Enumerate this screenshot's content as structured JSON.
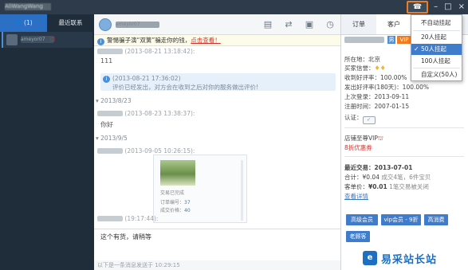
{
  "window": {
    "title": "AliWangWang 2014",
    "controls": {
      "min": "–",
      "max": "□",
      "close": "×"
    },
    "plugin_icon": "☎"
  },
  "left_panel": {
    "tabs": [
      {
        "label": "👤 (1)",
        "icon": "person-icon"
      },
      {
        "label": "最近联系"
      }
    ],
    "contact": {
      "name": "ameyor07",
      "badge": "⛫"
    }
  },
  "chat": {
    "header_name": "ameyor07",
    "tools": [
      "document-icon",
      "transfer-icon",
      "image-icon",
      "clock-icon"
    ],
    "notice": {
      "text": "警惕骗子演“双簧”骗走你的钱，",
      "link": "点击查看！"
    },
    "messages": [
      {
        "head": "(2013-08-21 13:18:42):",
        "body": "111"
      },
      {
        "head": "(2013-08-23 13:38:37):",
        "body": "你好"
      },
      {
        "head": "(2013-09-05 10:26:15):"
      },
      {
        "head": "(19:17:44):",
        "body": "这个有货，请稍等"
      }
    ],
    "system_msg": {
      "time": "(2013-08-21 17:36:02)",
      "text": "评价已经发出，对方会在收到之后对你的服务做出评价!"
    },
    "dates": [
      "▾ 2013/8/23",
      "▾ 2013/9/5"
    ],
    "item_card": {
      "caption": "交易已完成",
      "order_label": "订单编号：",
      "order_value": "37",
      "paid_label": "成交价格：",
      "paid_value": "40"
    },
    "bottom_hint": "以下是一条消息发送于 10:29:15"
  },
  "right_panel": {
    "tabs": [
      "订单",
      "客户"
    ],
    "tag_male": "男",
    "tag_vip": "VIP",
    "location_label": "所在地：",
    "location": "北京",
    "buyer_credit_label": "买家信誉：",
    "recv_rate_label": "收到好评率：",
    "recv_rate": "100.00%",
    "sent_rate_label": "发出好评率(180天)：",
    "sent_rate": "100.00%",
    "last_login_label": "上次登录：",
    "last_login": "2013-09-11",
    "reg_label": "注册时间：",
    "reg_date": "2007-01-15",
    "auth_label": "认证：",
    "vip_label": "店铺至尊VIP",
    "vip_discount": "8折优惠券",
    "recent_trade_label": "最近交易：",
    "recent_trade_date": "2013-07-01",
    "total_label": "合计：",
    "total_value": "¥0.04",
    "total_note": "成交4笔，6件宝贝",
    "ticket_label": "客单价：",
    "ticket_value": "¥0.01",
    "ticket_note": "1笔交易被关闭",
    "details_link": "查看详情",
    "member_buttons": [
      "高级会员",
      "vip会员 - 9折",
      "高消费",
      "老顾客"
    ]
  },
  "dropdown": {
    "items": [
      "不自动挂起",
      "20人挂起",
      "50人挂起",
      "100人挂起",
      "自定义(50人)"
    ],
    "selected_index": 2
  },
  "watermark": {
    "logo": "e",
    "text": "易采站长站"
  },
  "colors": {
    "accent": "#3f7ccb",
    "title_bar": "#2d3b4a",
    "highlight_border": "#f07c21"
  }
}
